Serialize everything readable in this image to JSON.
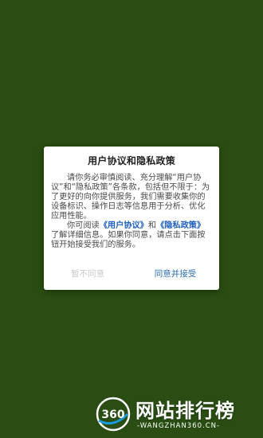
{
  "colors": {
    "background": "#294d12",
    "dialog_bg": "#ffffff",
    "link": "#1f5fbf",
    "agree": "#2a6db5",
    "disagree": "#c8c8c8"
  },
  "dialog": {
    "title": "用户协议和隐私政策",
    "para1": "请你务必审慎阅读、充分理解“用户协议”和“隐私政策”各条款，包括但不限于：为了更好的向你提供服务，我们需要收集你的设备标识、操作日志等信息用于分析、优化应用性能。",
    "para2_prefix": "你可阅读",
    "link_user_agreement": "《用户协议》",
    "para2_and": "和",
    "link_privacy_policy": "《隐私政策》",
    "para2_suffix": "了解详细信息。如果你同意，请点击下面按钮开始接受我们的服务。",
    "disagree_label": "暂不同意",
    "agree_label": "同意并接受"
  },
  "watermark": {
    "logo_text": "360",
    "brand": "网站排行榜",
    "url": "-WANGZHAN360.CN-"
  }
}
